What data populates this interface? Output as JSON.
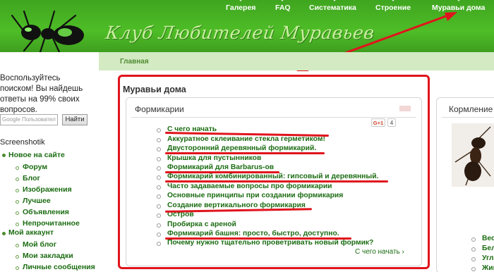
{
  "top_nav": [
    {
      "label": "Галерея"
    },
    {
      "label": "FAQ"
    },
    {
      "label": "Систематика"
    },
    {
      "label": "Строение"
    },
    {
      "label": "Муравьи дома",
      "active": true
    }
  ],
  "site": {
    "title": "Клуб Любителей Муравьев"
  },
  "breadcrumb": {
    "home": "Главная"
  },
  "sidebar": {
    "search_hint": "Воспользуйтесь поиском! Вы найдешь ответы на 99% своих вопросов.",
    "search_placeholder": "Google Пользовател",
    "search_button": "Найти",
    "user_heading": "Screenshotik",
    "groups": [
      {
        "label": "Новое на сайте",
        "items": [
          "Форум",
          "Блог",
          "Изображения",
          "Лучшее",
          "Объявления",
          "Непрочитанное"
        ]
      },
      {
        "label": "Мой аккаунт",
        "items": [
          "Мой блог",
          "Мои закладки",
          "Личные сообщения"
        ]
      }
    ]
  },
  "main": {
    "page_title": "Муравьи дома",
    "panel_title": "Формикарии",
    "gplus_label": "G+1",
    "gplus_count": "4",
    "items": [
      "С чего начать",
      "Аккуратное склеивание стекла герметиком!",
      "Двусторонний деревянный формикарий.",
      "Крышка для пустынников",
      "Формикарий для Barbarus-ов",
      "Формикарий комбинированный: гипсовый и деревянный.",
      "Часто задаваемые вопросы про формикарии",
      "Основные принципы при создании формикария",
      "Создание вертикального формикария",
      "Остров",
      "Пробирка с ареной",
      "Формикарий башня: просто, быстро, доступно.",
      "Почему нужно тщательно проветривать новый формик?"
    ],
    "more_link": "С чего начать ›"
  },
  "right_panel": {
    "title": "Кормление",
    "items": [
      "Вес",
      "Бел",
      "Угл",
      "Жив"
    ]
  },
  "colors": {
    "header_green": "#4ebd27",
    "link_green": "#1b6c12",
    "highlight_red": "#e0141c"
  }
}
